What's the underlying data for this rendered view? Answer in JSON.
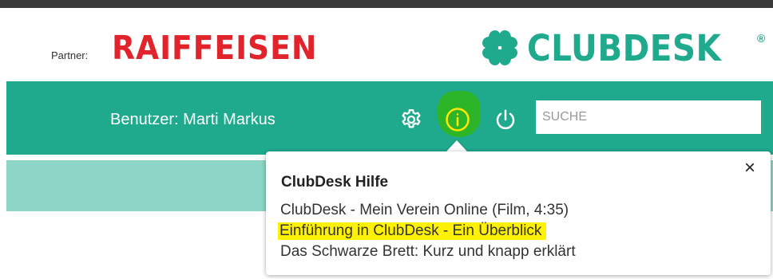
{
  "header": {
    "partner_label": "Partner:",
    "partner_logo_text": "RAIFFEISEN",
    "brand_text": "CLUBDESK",
    "brand_registered": "®"
  },
  "toolbar": {
    "user_label": "Benutzer: Marti Markus",
    "search_placeholder": "SUCHE",
    "search_value": "",
    "icons": [
      "gear-icon",
      "info-icon",
      "power-icon"
    ]
  },
  "help_popover": {
    "title": "ClubDesk Hilfe",
    "close_symbol": "×",
    "links": [
      "ClubDesk - Mein Verein Online (Film, 4:35)",
      "Einführung in ClubDesk - Ein Überblick",
      "Das Schwarze Brett: Kurz und knapp erklärt"
    ]
  },
  "colors": {
    "brand_teal": "#1faa8e",
    "light_teal": "#8dd5c6",
    "raiffeisen_red": "#e1242b",
    "info_highlight_green": "#2db52a",
    "info_icon_yellow": "#ffe600",
    "link_highlight_yellow": "#fff200",
    "top_bar": "#3a3a3a"
  }
}
